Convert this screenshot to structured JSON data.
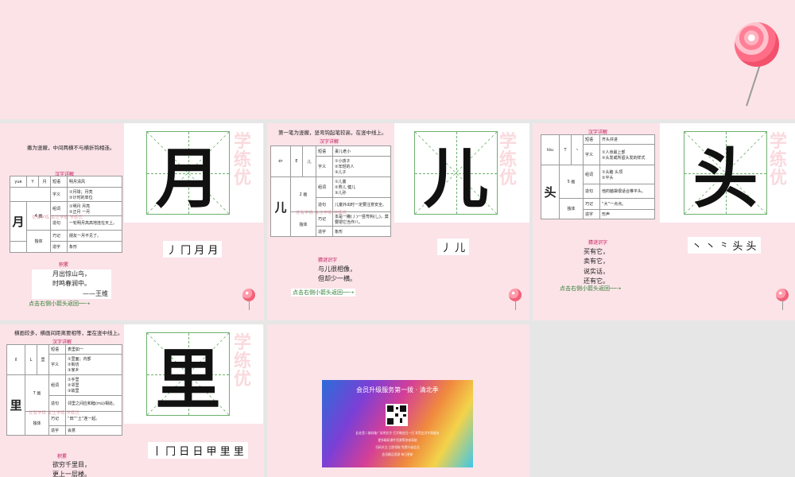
{
  "colors": {
    "slide_bg": "#fbe3e8",
    "grid_green": "#6fb06f",
    "title_pink": "#c2185b",
    "back_green": "#2e7d32"
  },
  "icons": {
    "lollipop": "lollipop-icon",
    "pin": "lollipop-pin-icon",
    "arrow": "right-arrow-icon"
  },
  "watermark": {
    "chars": "学练优",
    "sub": "优有学练 关注学练 学练优"
  },
  "slide1": {
    "note": "撇为竖撇，中间两横不与横折钩相连。",
    "table_title": "汉字详解",
    "char": "月",
    "pinyin": "yuè",
    "radical_label": "Y",
    "radical": "月",
    "strokes": "4 画",
    "rows": [
      {
        "k": "短语",
        "v": "明月清风"
      },
      {
        "k": "字义",
        "v": "①月球；月亮\n②计时的单位"
      },
      {
        "k": "组词",
        "v": "①明月  月亮\n②正月  一月"
      },
      {
        "k": "造句",
        "v": "一轮明月高高地挂在天上。"
      },
      {
        "k": "巧记",
        "v": "朋友一月不见了。"
      },
      {
        "k": "造字",
        "v": "象形"
      }
    ],
    "structure": "独体",
    "stroke_order": "丿 冂 月 月",
    "poem_title": "积累",
    "poem": [
      "月出惊山鸟，",
      "时鸣春涧中。",
      "——王维"
    ],
    "back": "点击右侧小箭头返回"
  },
  "slide2": {
    "note": "第一笔为竖撇，竖弯钩起笔较高，在竖中线上。",
    "table_title": "汉字详解",
    "char": "儿",
    "pinyin": "ér",
    "radical_label": "E",
    "radical": "儿",
    "strokes": "2 画",
    "rows": [
      {
        "k": "短语",
        "v": "妻儿老小"
      },
      {
        "k": "字义",
        "v": "①小孩子\n②年轻的人\n③儿子"
      },
      {
        "k": "组词",
        "v": "①儿童\n②男儿  健儿\n③儿孙"
      },
      {
        "k": "造句",
        "v": "儿童外出时一定要注意安全。"
      },
      {
        "k": "巧记",
        "v": "本是一撇(丿)一竖弯钩(乚)，莫要把它当作八。"
      },
      {
        "k": "造字",
        "v": "象形"
      }
    ],
    "structure": "独体",
    "stroke_order": "丿 儿",
    "poem_title": "猜谜识字",
    "poem": [
      "与儿很相像，",
      "但却少一横。"
    ],
    "back": "点击右侧小箭头返回"
  },
  "slide3": {
    "note": "",
    "table_title": "汉字详解",
    "char": "头",
    "pinyin": "tóu",
    "radical_label": "T",
    "radical": "丶",
    "strokes": "5 画",
    "rows": [
      {
        "k": "短语",
        "v": "齐头并进"
      },
      {
        "k": "字义",
        "v": "①人身最上部\n②头发或所留头发的样式"
      },
      {
        "k": "组词",
        "v": "①头脑  头顶\n②平头"
      },
      {
        "k": "造句",
        "v": "他的脑袋很适合推平头。"
      },
      {
        "k": "巧记",
        "v": "“大”一点点。"
      },
      {
        "k": "造字",
        "v": "形声"
      }
    ],
    "structure": "独体",
    "stroke_order": "丶 丶 ⺀ 头 头",
    "poem_title": "猜谜识字",
    "poem": [
      "买有它，",
      "卖有它，",
      "说实话，",
      "还有它。"
    ],
    "back": "点击右侧小箭头返回"
  },
  "slide4": {
    "note": "横画较多，横画间距离要相等，里在竖中线上。",
    "table_title": "汉字详解",
    "char": "里",
    "pinyin": "lǐ",
    "radical_label": "L",
    "radical": "里",
    "strokes": "7 画",
    "rows": [
      {
        "k": "短语",
        "v": "表里如一"
      },
      {
        "k": "字义",
        "v": "①里面；内部\n②街坊\n③家乡"
      },
      {
        "k": "组词",
        "v": "①手里\n②邻里\n③故里"
      },
      {
        "k": "造句",
        "v": "邻里之间应和睦(mù)相处。"
      },
      {
        "k": "巧记",
        "v": "“田”“土”连一起。"
      },
      {
        "k": "造字",
        "v": "会意"
      }
    ],
    "structure": "独体",
    "stroke_order": "丨 冂 日 日 甲 里 里",
    "poem_title": "积累",
    "poem": [
      "欲穷千里目，",
      "更上一层楼。"
    ]
  },
  "slide5": {
    "ad_title": "会员升级服务第一拨 · 清北季",
    "ad_lines": [
      "此处是二维码推广说明文字 打开微信扫一扫 享受会员专属服务",
      "更多精彩课件资源等你来获取",
      "扫码关注 立即领取 免费升级会员",
      "会员精品资源 每日更新"
    ]
  }
}
